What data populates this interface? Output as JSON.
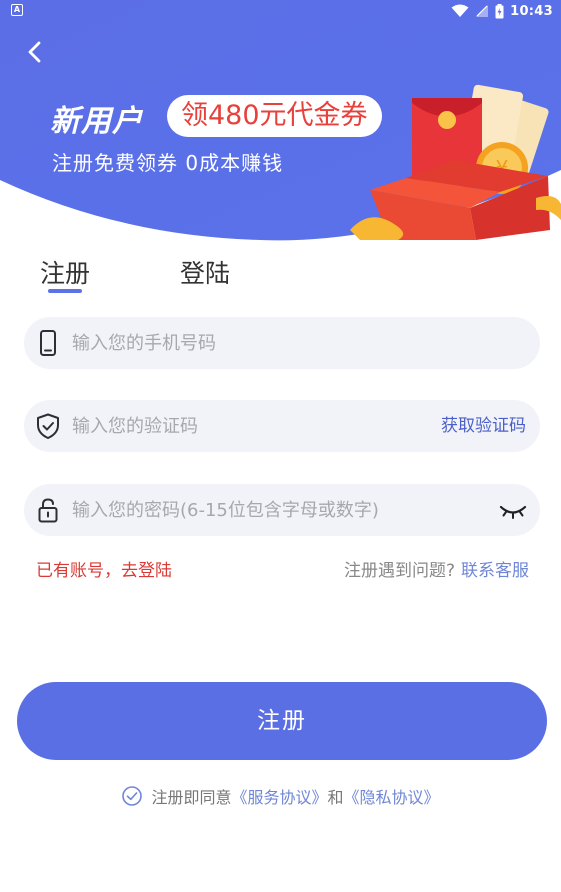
{
  "status_bar": {
    "app_indicator": "A",
    "time": "10:43"
  },
  "colors": {
    "brand": "#5a6fe3",
    "accent_red": "#d93a35",
    "link_blue": "#6f86d6",
    "field_bg": "#f2f3f8"
  },
  "banner": {
    "title": "新用户",
    "pill_text": "领480元代金券",
    "subtitle": "注册免费领券 0成本赚钱"
  },
  "tabs": [
    {
      "label": "注册",
      "active": true
    },
    {
      "label": "登陆",
      "active": false
    }
  ],
  "form": {
    "phone": {
      "icon": "phone-icon",
      "placeholder": "输入您的手机号码",
      "value": ""
    },
    "code": {
      "icon": "shield-check-icon",
      "placeholder": "输入您的验证码",
      "value": "",
      "action": "获取验证码"
    },
    "password": {
      "icon": "lock-icon",
      "placeholder": "输入您的密码(6-15位包含字母或数字)",
      "value": "",
      "toggle_icon": "eye-closed-icon"
    }
  },
  "links": {
    "have_account": "已有账号，去登陆",
    "problem": "注册遇到问题?",
    "contact": "联系客服"
  },
  "register_button": "注册",
  "agreement": {
    "prefix": "注册即同意",
    "service": "《服务协议》",
    "and": "和",
    "privacy": "《隐私协议》"
  }
}
